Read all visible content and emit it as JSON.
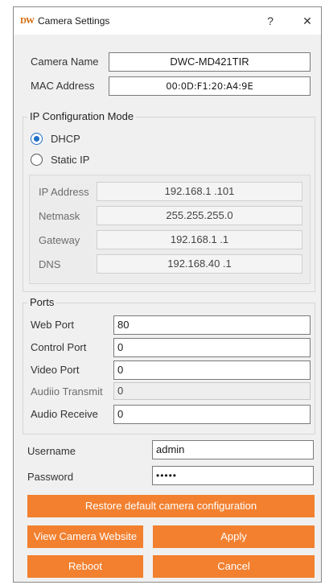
{
  "window": {
    "logo": "DW",
    "title": "Camera Settings",
    "help_label": "?",
    "close_label": "✕"
  },
  "camera": {
    "name_label": "Camera Name",
    "name_value": "DWC-MD421TIR",
    "mac_label": "MAC Address",
    "mac_value": "00:0D:F1:20:A4:9E"
  },
  "ip_config": {
    "group_title": "IP Configuration Mode",
    "dhcp_label": "DHCP",
    "static_label": "Static IP",
    "selected": "DHCP",
    "ip_label": "IP Address",
    "ip_value": "192.168.1 .101",
    "netmask_label": "Netmask",
    "netmask_value": "255.255.255.0",
    "gateway_label": "Gateway",
    "gateway_value": "192.168.1 .1",
    "dns_label": "DNS",
    "dns_value": "192.168.40 .1"
  },
  "ports": {
    "group_title": "Ports",
    "web_label": "Web Port",
    "web_value": "80",
    "control_label": "Control Port",
    "control_value": "0",
    "video_label": "Video Port",
    "video_value": "0",
    "audio_tx_label": "Audiio Transmit",
    "audio_tx_value": "0",
    "audio_rx_label": "Audio Receive",
    "audio_rx_value": "0"
  },
  "auth": {
    "username_label": "Username",
    "username_value": "admin",
    "password_label": "Password",
    "password_value": "•••••"
  },
  "buttons": {
    "restore": "Restore default camera configuration",
    "website": "View Camera Website",
    "apply": "Apply",
    "reboot": "Reboot",
    "cancel": "Cancel"
  },
  "colors": {
    "accent": "#f2802f",
    "radio_selected": "#1f6fc7"
  }
}
